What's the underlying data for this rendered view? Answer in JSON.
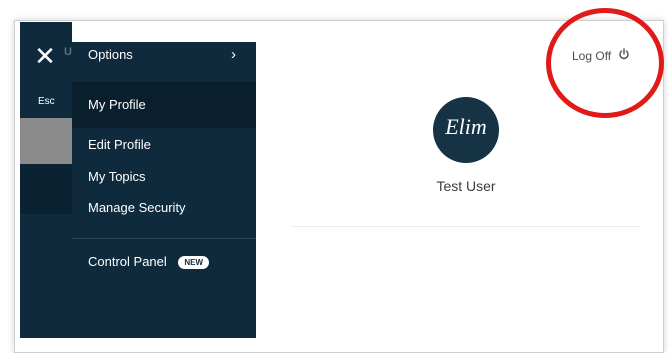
{
  "close": {
    "hint": "Esc",
    "ghost": "UR"
  },
  "menu": {
    "options_label": "Options",
    "items": [
      {
        "label": "My Profile"
      },
      {
        "label": "Edit Profile"
      },
      {
        "label": "My Topics"
      },
      {
        "label": "Manage Security"
      }
    ],
    "control_panel": {
      "label": "Control Panel",
      "badge": "NEW"
    }
  },
  "header": {
    "logoff_label": "Log Off"
  },
  "profile": {
    "avatar_text": "Elim",
    "user_name": "Test User"
  },
  "colors": {
    "sidebar": "#0f2a3d",
    "highlight": "#e01919"
  }
}
